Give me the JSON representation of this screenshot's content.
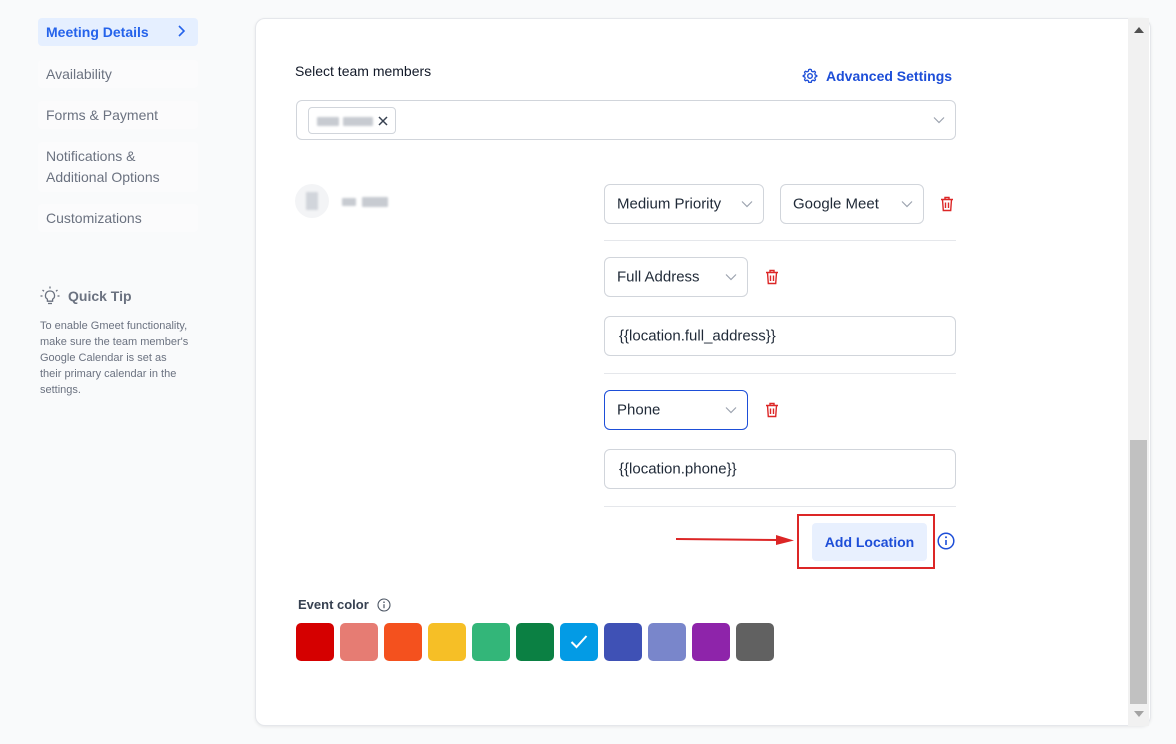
{
  "sidebar": {
    "items": [
      {
        "label": "Meeting Details",
        "active": true
      },
      {
        "label": "Availability"
      },
      {
        "label": "Forms & Payment"
      },
      {
        "label": "Notifications & Additional Options"
      },
      {
        "label": "Customizations"
      }
    ],
    "tip": {
      "title": "Quick Tip",
      "body": "To enable Gmeet functionality, make sure the team member's Google Calendar is set as their primary calendar in the settings."
    }
  },
  "form": {
    "team_members_label": "Select team members",
    "advanced_settings": "Advanced Settings",
    "priority_select": "Medium Priority",
    "meeting_type_select": "Google Meet",
    "location1": {
      "type": "Full Address",
      "value": "{{location.full_address}}"
    },
    "location2": {
      "type": "Phone",
      "value": "{{location.phone}}"
    },
    "add_location": "Add Location",
    "event_color_label": "Event color"
  },
  "colors": {
    "accent": "#1d4ed8",
    "swatches": [
      "#d50000",
      "#e67c73",
      "#f4511e",
      "#f6bf26",
      "#33b679",
      "#0b8043",
      "#039be5",
      "#3f51b5",
      "#7986cb",
      "#8e24aa",
      "#616161"
    ],
    "selected_swatch": 6
  }
}
